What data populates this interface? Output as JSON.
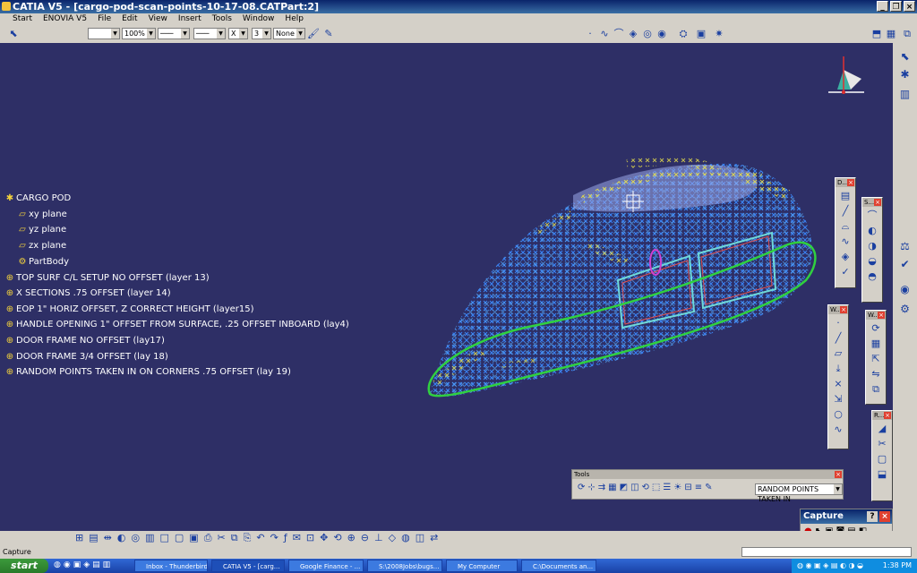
{
  "window": {
    "title": "CATIA V5 - [cargo-pod-scan-points-10-17-08.CATPart:2]"
  },
  "menu": [
    "Start",
    "ENOVIA V5",
    "File",
    "Edit",
    "View",
    "Insert",
    "Tools",
    "Window",
    "Help"
  ],
  "toolbar": {
    "zoom": "100%",
    "layer_value": "3",
    "layer_filter": "None",
    "x_value": "X"
  },
  "tree": {
    "root": "CARGO POD",
    "items": [
      "xy plane",
      "yz plane",
      "zx plane",
      "PartBody",
      "TOP SURF C/L SETUP NO OFFSET (layer 13)",
      "X SECTIONS .75 OFFSET (layer 14)",
      "EOP 1\" HORIZ OFFSET, Z CORRECT HEIGHT (layer15)",
      "HANDLE OPENING 1\" OFFSET FROM SURFACE, .25 OFFSET INBOARD (lay4)",
      "DOOR FRAME  NO OFFSET (lay17)",
      "DOOR FRAME 3/4 OFFSET (lay 18)",
      "RANDOM POINTS TAKEN IN ON CORNERS .75 OFFSET (lay 19)"
    ]
  },
  "tools_palette": {
    "title": "Tools",
    "combo_value": "RANDOM POINTS TAKEN IN"
  },
  "capture": {
    "title": "Capture"
  },
  "statusbar": {
    "text": "Capture"
  },
  "taskbar": {
    "start": "start",
    "tasks": [
      "Inbox - Thunderbird",
      "CATIA V5 - [carg...",
      "Google Finance - ...",
      "S:\\2008Jobs\\bugs...",
      "My Computer",
      "C:\\Documents an..."
    ],
    "clock": "1:38 PM"
  },
  "palettes": [
    {
      "title": "D..."
    },
    {
      "title": "S..."
    },
    {
      "title": "W..."
    },
    {
      "title": "W..."
    },
    {
      "title": "R..."
    }
  ]
}
